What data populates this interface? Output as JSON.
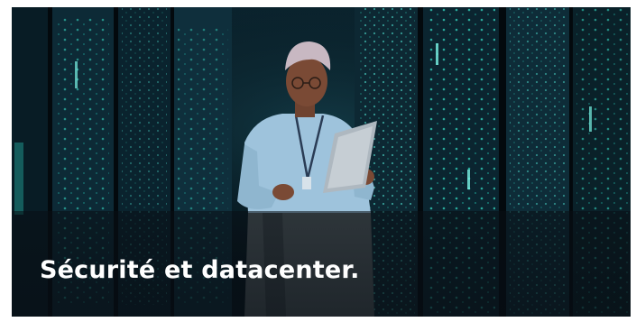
{
  "banner": {
    "title": "Sécurité et datacenter.",
    "accent_color": "#2fd2c0",
    "background_color": "#061620"
  }
}
